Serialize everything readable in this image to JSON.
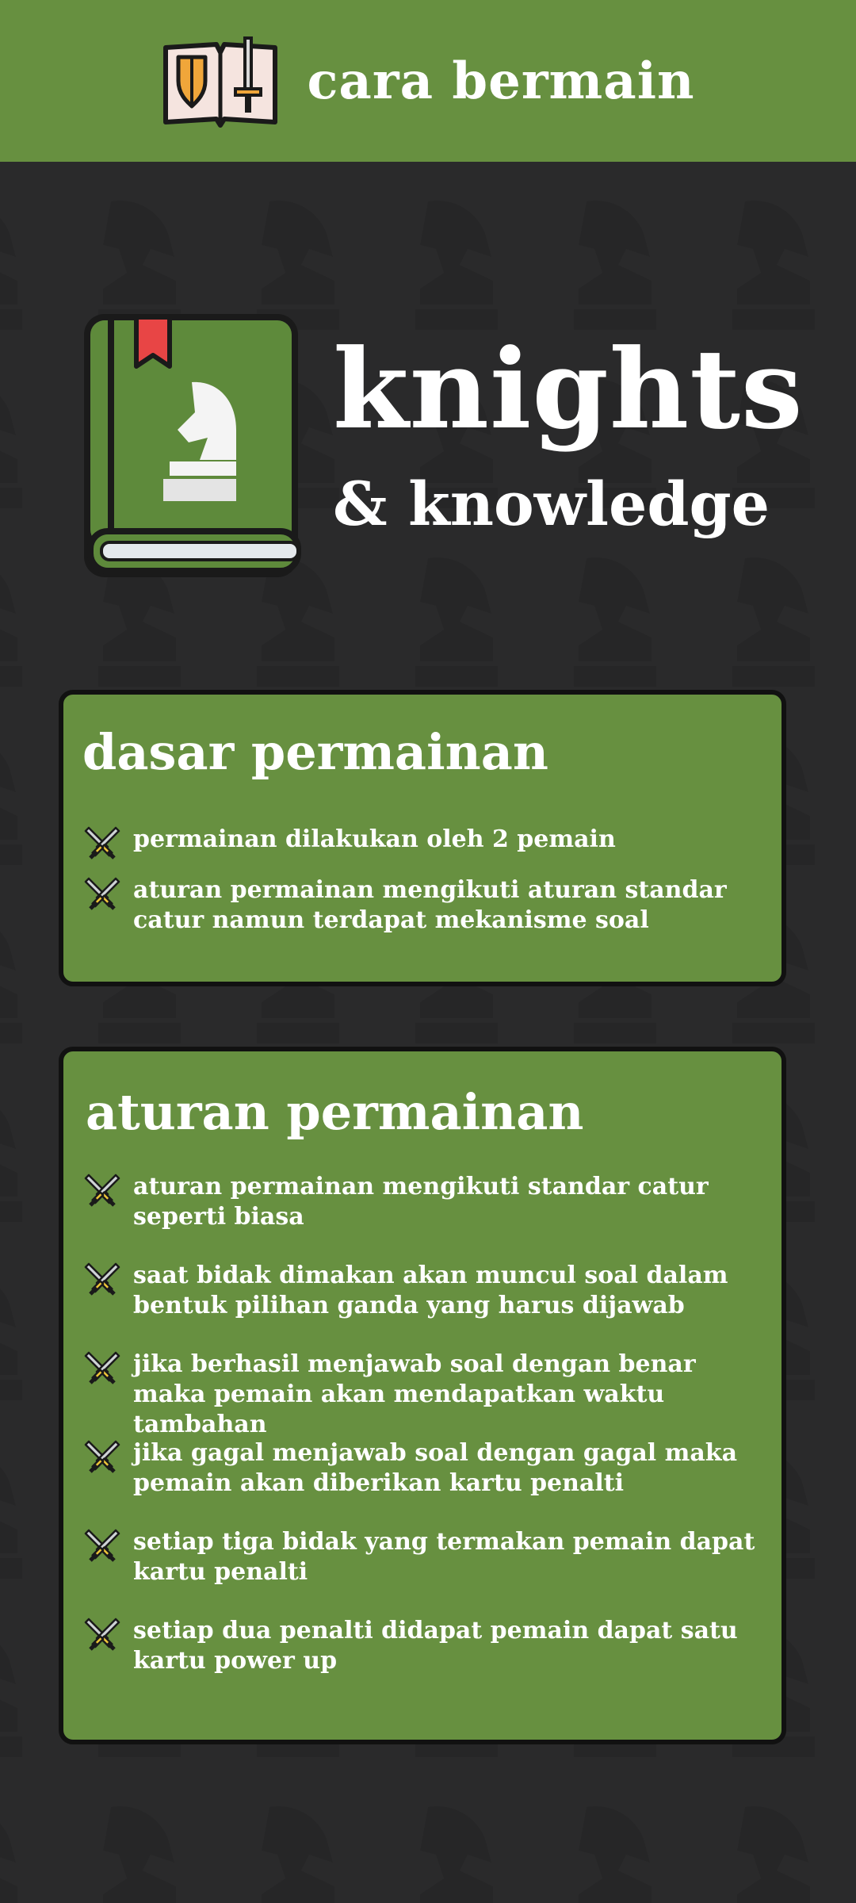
{
  "header": {
    "title": "cara bermain",
    "icon": "book-shield-sword-icon"
  },
  "hero": {
    "brand_main": "knights",
    "brand_sub": "& knowledge",
    "icon": "chess-knight-book-icon"
  },
  "dasar": {
    "title": "dasar permainan",
    "items": [
      "permainan dilakukan oleh 2 pemain",
      "aturan permainan mengikuti aturan standar catur namun terdapat mekanisme soal"
    ]
  },
  "aturan": {
    "title": "aturan permainan",
    "items": [
      "aturan permainan mengikuti standar catur seperti biasa",
      "saat bidak dimakan akan muncul soal dalam bentuk pilihan ganda yang harus dijawab",
      "jika berhasil menjawab soal dengan benar maka pemain akan mendapatkan waktu tambahan",
      "jika gagal menjawab soal dengan gagal maka pemain akan diberikan kartu penalti",
      "setiap tiga bidak yang termakan pemain dapat kartu penalti",
      "setiap dua penalti didapat pemain dapat satu kartu power up"
    ]
  },
  "colors": {
    "header": "#679040",
    "background": "#2a2a2b",
    "card": "#679040",
    "border": "#111111"
  }
}
